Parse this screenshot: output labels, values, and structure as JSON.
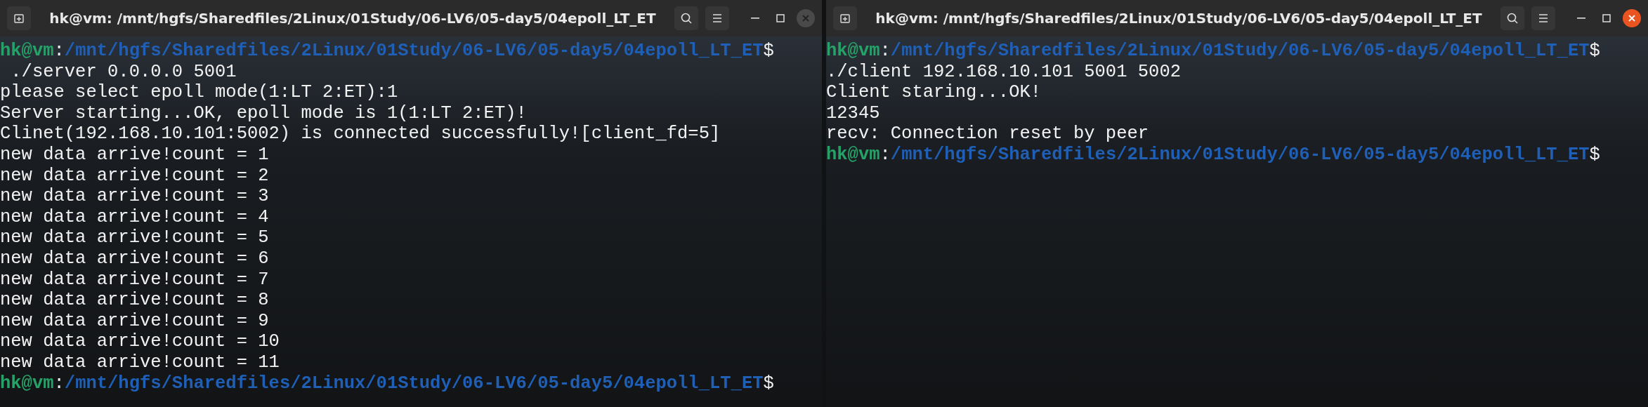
{
  "windows": [
    {
      "title": "hk@vm: /mnt/hgfs/Sharedfiles/2Linux/01Study/06-LV6/05-day5/04epoll_LT_ET",
      "active": false,
      "lines": [
        {
          "kind": "prompt",
          "user_host": "hk@vm",
          "separator": ":",
          "path": "/mnt/hgfs/Sharedfiles/2Linux/01Study/06-LV6/05-day5/04epoll_LT_ET",
          "symbol": "$"
        },
        {
          "kind": "output",
          "text": " ./server 0.0.0.0 5001"
        },
        {
          "kind": "output",
          "text": "please select epoll mode(1:LT 2:ET):1"
        },
        {
          "kind": "output",
          "text": "Server starting...OK, epoll mode is 1(1:LT 2:ET)!"
        },
        {
          "kind": "output",
          "text": "Clinet(192.168.10.101:5002) is connected successfully![client_fd=5]"
        },
        {
          "kind": "output",
          "text": "new data arrive!count = 1"
        },
        {
          "kind": "output",
          "text": "new data arrive!count = 2"
        },
        {
          "kind": "output",
          "text": "new data arrive!count = 3"
        },
        {
          "kind": "output",
          "text": "new data arrive!count = 4"
        },
        {
          "kind": "output",
          "text": "new data arrive!count = 5"
        },
        {
          "kind": "output",
          "text": "new data arrive!count = 6"
        },
        {
          "kind": "output",
          "text": "new data arrive!count = 7"
        },
        {
          "kind": "output",
          "text": "new data arrive!count = 8"
        },
        {
          "kind": "output",
          "text": "new data arrive!count = 9"
        },
        {
          "kind": "output",
          "text": "new data arrive!count = 10"
        },
        {
          "kind": "output",
          "text": "new data arrive!count = 11"
        },
        {
          "kind": "prompt",
          "user_host": "hk@vm",
          "separator": ":",
          "path": "/mnt/hgfs/Sharedfiles/2Linux/01Study/06-LV6/05-day5/04epoll_LT_ET",
          "symbol": "$"
        }
      ]
    },
    {
      "title": "hk@vm: /mnt/hgfs/Sharedfiles/2Linux/01Study/06-LV6/05-day5/04epoll_LT_ET",
      "active": true,
      "lines": [
        {
          "kind": "prompt",
          "user_host": "hk@vm",
          "separator": ":",
          "path": "/mnt/hgfs/Sharedfiles/2Linux/01Study/06-LV6/05-day5/04epoll_LT_ET",
          "symbol": "$"
        },
        {
          "kind": "output",
          "text": "./client 192.168.10.101 5001 5002"
        },
        {
          "kind": "output",
          "text": "Client staring...OK!"
        },
        {
          "kind": "output",
          "text": "12345"
        },
        {
          "kind": "output",
          "text": "recv: Connection reset by peer"
        },
        {
          "kind": "prompt",
          "user_host": "hk@vm",
          "separator": ":",
          "path": "/mnt/hgfs/Sharedfiles/2Linux/01Study/06-LV6/05-day5/04epoll_LT_ET",
          "symbol": "$"
        }
      ]
    }
  ]
}
